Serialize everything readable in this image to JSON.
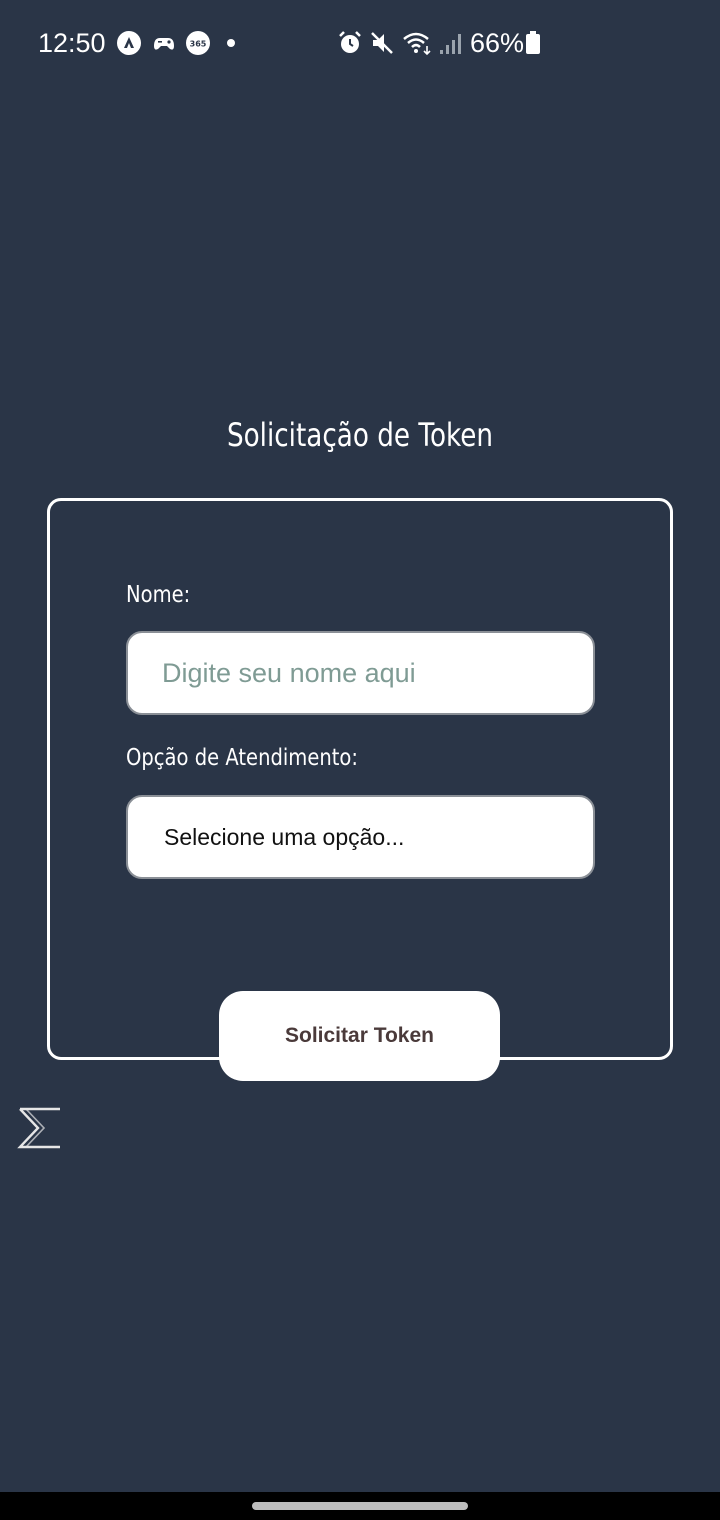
{
  "status_bar": {
    "time": "12:50",
    "battery_percent": "66%",
    "icons": [
      "nav-arrow-icon",
      "gamepad-icon",
      "365-icon",
      "dot-icon",
      "alarm-icon",
      "mute-icon",
      "wifi-icon",
      "signal-icon",
      "battery-icon"
    ]
  },
  "page": {
    "title": "Solicitação de Token"
  },
  "form": {
    "name_label": "Nome:",
    "name_value": "",
    "name_placeholder": "Digite seu nome aqui",
    "option_label": "Opção de Atendimento:",
    "option_selected": "Selecione uma opção...",
    "submit_label": "Solicitar Token"
  },
  "colors": {
    "background": "#2a3547",
    "card_border": "#ffffff",
    "placeholder": "#7f9b94",
    "button_text": "#4a3a3a"
  }
}
